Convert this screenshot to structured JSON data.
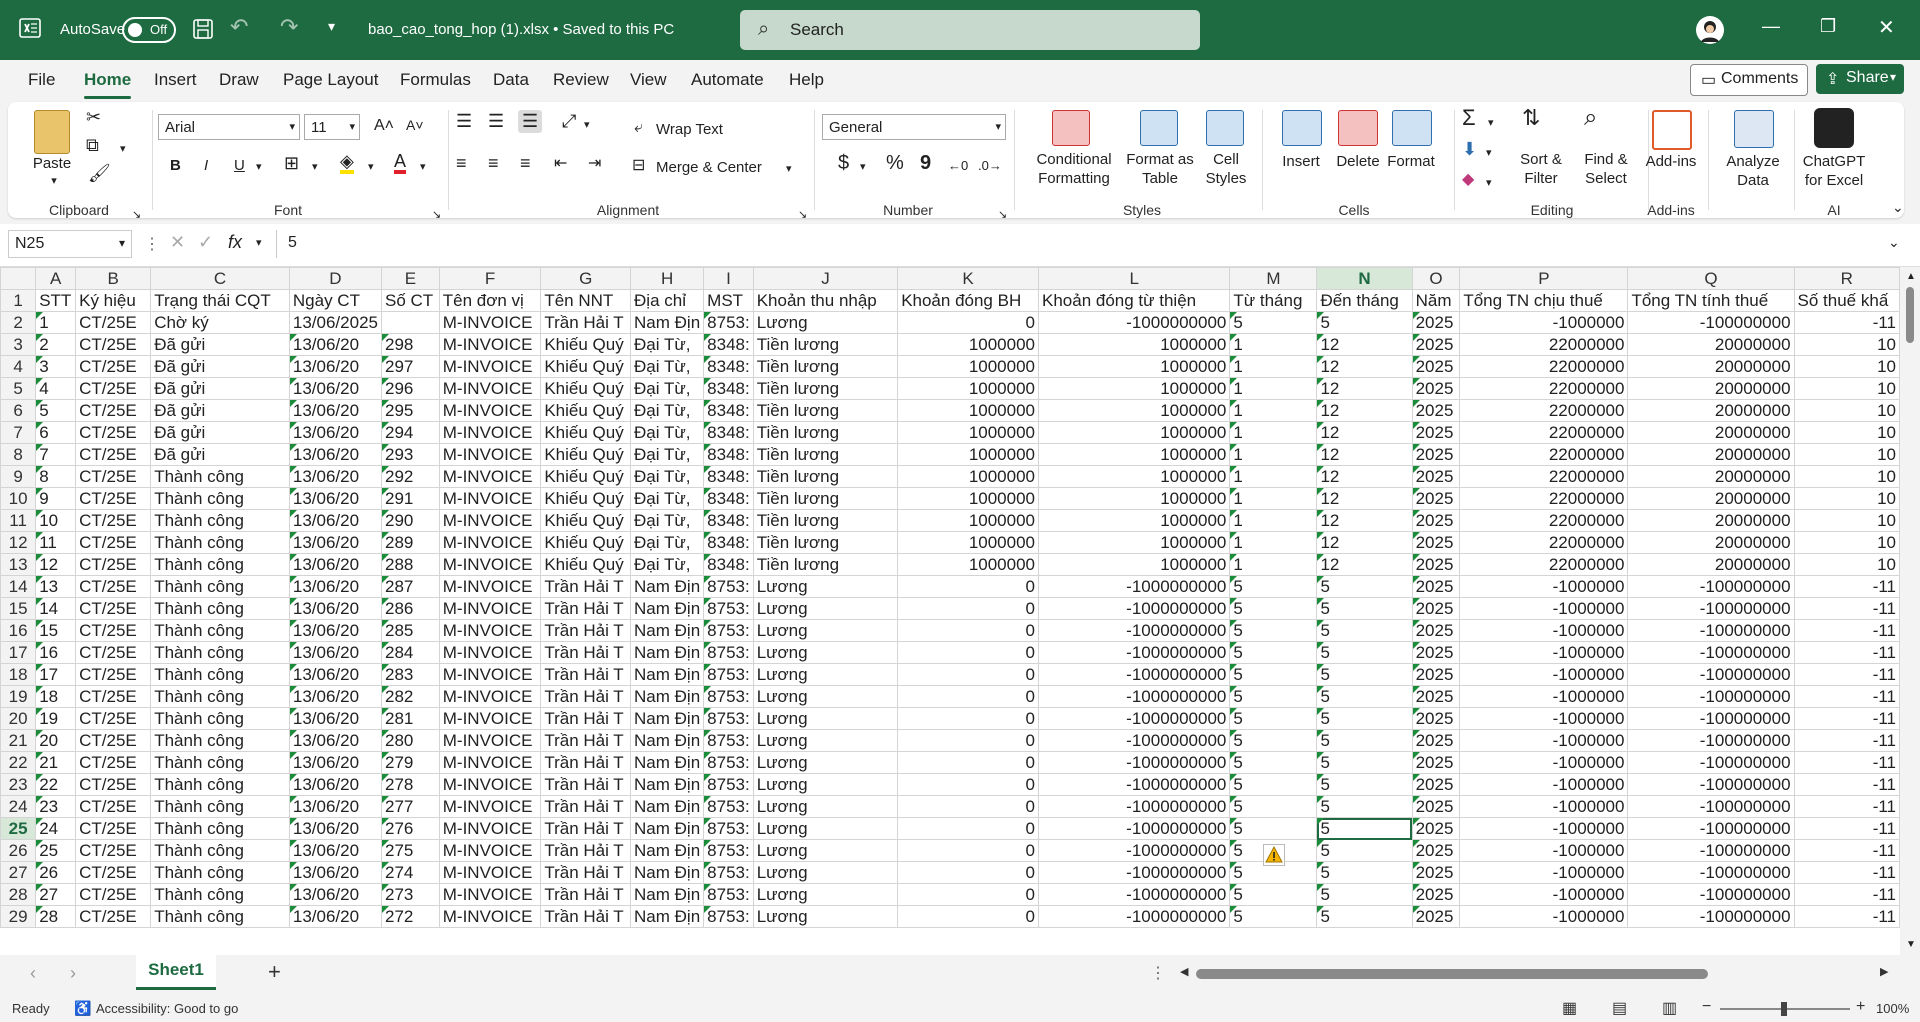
{
  "titlebar": {
    "autosave_label": "AutoSave",
    "toggle_text": "Off",
    "filename": "bao_cao_tong_hop (1).xlsx • Saved to this PC",
    "search_placeholder": "Search"
  },
  "menu": {
    "tabs": [
      "File",
      "Home",
      "Insert",
      "Draw",
      "Page Layout",
      "Formulas",
      "Data",
      "Review",
      "View",
      "Automate",
      "Help"
    ],
    "comments": "Comments",
    "share": "Share"
  },
  "ribbon": {
    "clipboard": {
      "paste": "Paste",
      "label": "Clipboard"
    },
    "font": {
      "name": "Arial",
      "size": "11",
      "label": "Font",
      "bold": "B",
      "italic": "I",
      "underline": "U"
    },
    "alignment": {
      "wrap": "Wrap Text",
      "merge": "Merge & Center",
      "label": "Alignment"
    },
    "number": {
      "format": "General",
      "dollar": "$",
      "percent": "%",
      "comma": "9",
      "label": "Number"
    },
    "styles": {
      "conditional": "Conditional\nFormatting",
      "format_table": "Format as\nTable",
      "cell_styles": "Cell\nStyles",
      "label": "Styles"
    },
    "cells": {
      "insert": "Insert",
      "delete": "Delete",
      "format": "Format",
      "label": "Cells"
    },
    "editing": {
      "sort": "Sort &\nFilter",
      "find": "Find &\nSelect",
      "label": "Editing"
    },
    "addins": {
      "addins": "Add-ins",
      "label": "Add-ins"
    },
    "analyze": {
      "text": "Analyze\nData"
    },
    "ai": {
      "chatgpt": "ChatGPT\nfor Excel",
      "label": "AI"
    }
  },
  "formula_bar": {
    "name_box": "N25",
    "fx": "fx",
    "value": "5"
  },
  "grid": {
    "columns": [
      "A",
      "B",
      "C",
      "D",
      "E",
      "F",
      "G",
      "H",
      "I",
      "J",
      "K",
      "L",
      "M",
      "N",
      "O",
      "P",
      "Q",
      "R"
    ],
    "selected_column": "N",
    "selected_row": 25,
    "headers": [
      "STT",
      "Ký hiệu",
      "Trạng thái CQT",
      "Ngày CT",
      "Số CT",
      "Tên đơn vị",
      "Tên NNT",
      "Địa chỉ",
      "MST",
      "Khoản thu nhập",
      "Khoản đóng BH",
      "Khoản đóng từ thiện",
      "Từ tháng",
      "Đến tháng",
      "Năm",
      "Tổng TN chịu thuế",
      "Tổng TN tính thuế",
      "Số thuế khấ"
    ],
    "rows": [
      [
        "1",
        "CT/25E",
        "Chờ ký",
        "13/06/2025",
        "",
        "M-INVOICE",
        "Trần Hải T",
        "Nam Địn",
        "8753:",
        "Lương",
        "0",
        "-1000000000",
        "5",
        "5",
        "2025",
        "-1000000",
        "-100000000",
        "-11"
      ],
      [
        "2",
        "CT/25E",
        "Đã gửi",
        "13/06/20",
        "298",
        "M-INVOICE",
        "Khiếu Quý",
        "Đại Từ,",
        "8348:",
        "Tiền lương",
        "1000000",
        "1000000",
        "1",
        "12",
        "2025",
        "22000000",
        "20000000",
        "10"
      ],
      [
        "3",
        "CT/25E",
        "Đã gửi",
        "13/06/20",
        "297",
        "M-INVOICE",
        "Khiếu Quý",
        "Đại Từ,",
        "8348:",
        "Tiền lương",
        "1000000",
        "1000000",
        "1",
        "12",
        "2025",
        "22000000",
        "20000000",
        "10"
      ],
      [
        "4",
        "CT/25E",
        "Đã gửi",
        "13/06/20",
        "296",
        "M-INVOICE",
        "Khiếu Quý",
        "Đại Từ,",
        "8348:",
        "Tiền lương",
        "1000000",
        "1000000",
        "1",
        "12",
        "2025",
        "22000000",
        "20000000",
        "10"
      ],
      [
        "5",
        "CT/25E",
        "Đã gửi",
        "13/06/20",
        "295",
        "M-INVOICE",
        "Khiếu Quý",
        "Đại Từ,",
        "8348:",
        "Tiền lương",
        "1000000",
        "1000000",
        "1",
        "12",
        "2025",
        "22000000",
        "20000000",
        "10"
      ],
      [
        "6",
        "CT/25E",
        "Đã gửi",
        "13/06/20",
        "294",
        "M-INVOICE",
        "Khiếu Quý",
        "Đại Từ,",
        "8348:",
        "Tiền lương",
        "1000000",
        "1000000",
        "1",
        "12",
        "2025",
        "22000000",
        "20000000",
        "10"
      ],
      [
        "7",
        "CT/25E",
        "Đã gửi",
        "13/06/20",
        "293",
        "M-INVOICE",
        "Khiếu Quý",
        "Đại Từ,",
        "8348:",
        "Tiền lương",
        "1000000",
        "1000000",
        "1",
        "12",
        "2025",
        "22000000",
        "20000000",
        "10"
      ],
      [
        "8",
        "CT/25E",
        "Thành công",
        "13/06/20",
        "292",
        "M-INVOICE",
        "Khiếu Quý",
        "Đại Từ,",
        "8348:",
        "Tiền lương",
        "1000000",
        "1000000",
        "1",
        "12",
        "2025",
        "22000000",
        "20000000",
        "10"
      ],
      [
        "9",
        "CT/25E",
        "Thành công",
        "13/06/20",
        "291",
        "M-INVOICE",
        "Khiếu Quý",
        "Đại Từ,",
        "8348:",
        "Tiền lương",
        "1000000",
        "1000000",
        "1",
        "12",
        "2025",
        "22000000",
        "20000000",
        "10"
      ],
      [
        "10",
        "CT/25E",
        "Thành công",
        "13/06/20",
        "290",
        "M-INVOICE",
        "Khiếu Quý",
        "Đại Từ,",
        "8348:",
        "Tiền lương",
        "1000000",
        "1000000",
        "1",
        "12",
        "2025",
        "22000000",
        "20000000",
        "10"
      ],
      [
        "11",
        "CT/25E",
        "Thành công",
        "13/06/20",
        "289",
        "M-INVOICE",
        "Khiếu Quý",
        "Đại Từ,",
        "8348:",
        "Tiền lương",
        "1000000",
        "1000000",
        "1",
        "12",
        "2025",
        "22000000",
        "20000000",
        "10"
      ],
      [
        "12",
        "CT/25E",
        "Thành công",
        "13/06/20",
        "288",
        "M-INVOICE",
        "Khiếu Quý",
        "Đại Từ,",
        "8348:",
        "Tiền lương",
        "1000000",
        "1000000",
        "1",
        "12",
        "2025",
        "22000000",
        "20000000",
        "10"
      ],
      [
        "13",
        "CT/25E",
        "Thành công",
        "13/06/20",
        "287",
        "M-INVOICE",
        "Trần Hải T",
        "Nam Địn",
        "8753:",
        "Lương",
        "0",
        "-1000000000",
        "5",
        "5",
        "2025",
        "-1000000",
        "-100000000",
        "-11"
      ],
      [
        "14",
        "CT/25E",
        "Thành công",
        "13/06/20",
        "286",
        "M-INVOICE",
        "Trần Hải T",
        "Nam Địn",
        "8753:",
        "Lương",
        "0",
        "-1000000000",
        "5",
        "5",
        "2025",
        "-1000000",
        "-100000000",
        "-11"
      ],
      [
        "15",
        "CT/25E",
        "Thành công",
        "13/06/20",
        "285",
        "M-INVOICE",
        "Trần Hải T",
        "Nam Địn",
        "8753:",
        "Lương",
        "0",
        "-1000000000",
        "5",
        "5",
        "2025",
        "-1000000",
        "-100000000",
        "-11"
      ],
      [
        "16",
        "CT/25E",
        "Thành công",
        "13/06/20",
        "284",
        "M-INVOICE",
        "Trần Hải T",
        "Nam Địn",
        "8753:",
        "Lương",
        "0",
        "-1000000000",
        "5",
        "5",
        "2025",
        "-1000000",
        "-100000000",
        "-11"
      ],
      [
        "17",
        "CT/25E",
        "Thành công",
        "13/06/20",
        "283",
        "M-INVOICE",
        "Trần Hải T",
        "Nam Địn",
        "8753:",
        "Lương",
        "0",
        "-1000000000",
        "5",
        "5",
        "2025",
        "-1000000",
        "-100000000",
        "-11"
      ],
      [
        "18",
        "CT/25E",
        "Thành công",
        "13/06/20",
        "282",
        "M-INVOICE",
        "Trần Hải T",
        "Nam Địn",
        "8753:",
        "Lương",
        "0",
        "-1000000000",
        "5",
        "5",
        "2025",
        "-1000000",
        "-100000000",
        "-11"
      ],
      [
        "19",
        "CT/25E",
        "Thành công",
        "13/06/20",
        "281",
        "M-INVOICE",
        "Trần Hải T",
        "Nam Địn",
        "8753:",
        "Lương",
        "0",
        "-1000000000",
        "5",
        "5",
        "2025",
        "-1000000",
        "-100000000",
        "-11"
      ],
      [
        "20",
        "CT/25E",
        "Thành công",
        "13/06/20",
        "280",
        "M-INVOICE",
        "Trần Hải T",
        "Nam Địn",
        "8753:",
        "Lương",
        "0",
        "-1000000000",
        "5",
        "5",
        "2025",
        "-1000000",
        "-100000000",
        "-11"
      ],
      [
        "21",
        "CT/25E",
        "Thành công",
        "13/06/20",
        "279",
        "M-INVOICE",
        "Trần Hải T",
        "Nam Địn",
        "8753:",
        "Lương",
        "0",
        "-1000000000",
        "5",
        "5",
        "2025",
        "-1000000",
        "-100000000",
        "-11"
      ],
      [
        "22",
        "CT/25E",
        "Thành công",
        "13/06/20",
        "278",
        "M-INVOICE",
        "Trần Hải T",
        "Nam Địn",
        "8753:",
        "Lương",
        "0",
        "-1000000000",
        "5",
        "5",
        "2025",
        "-1000000",
        "-100000000",
        "-11"
      ],
      [
        "23",
        "CT/25E",
        "Thành công",
        "13/06/20",
        "277",
        "M-INVOICE",
        "Trần Hải T",
        "Nam Địn",
        "8753:",
        "Lương",
        "0",
        "-1000000000",
        "5",
        "5",
        "2025",
        "-1000000",
        "-100000000",
        "-11"
      ],
      [
        "24",
        "CT/25E",
        "Thành công",
        "13/06/20",
        "276",
        "M-INVOICE",
        "Trần Hải T",
        "Nam Địn",
        "8753:",
        "Lương",
        "0",
        "-1000000000",
        "5",
        "5",
        "2025",
        "-1000000",
        "-100000000",
        "-11"
      ],
      [
        "25",
        "CT/25E",
        "Thành công",
        "13/06/20",
        "275",
        "M-INVOICE",
        "Trần Hải T",
        "Nam Địn",
        "8753:",
        "Lương",
        "0",
        "-1000000000",
        "5",
        "5",
        "2025",
        "-1000000",
        "-100000000",
        "-11"
      ],
      [
        "26",
        "CT/25E",
        "Thành công",
        "13/06/20",
        "274",
        "M-INVOICE",
        "Trần Hải T",
        "Nam Địn",
        "8753:",
        "Lương",
        "0",
        "-1000000000",
        "5",
        "5",
        "2025",
        "-1000000",
        "-100000000",
        "-11"
      ],
      [
        "27",
        "CT/25E",
        "Thành công",
        "13/06/20",
        "273",
        "M-INVOICE",
        "Trần Hải T",
        "Nam Địn",
        "8753:",
        "Lương",
        "0",
        "-1000000000",
        "5",
        "5",
        "2025",
        "-1000000",
        "-100000000",
        "-11"
      ],
      [
        "28",
        "CT/25E",
        "Thành công",
        "13/06/20",
        "272",
        "M-INVOICE",
        "Trần Hải T",
        "Nam Địn",
        "8753:",
        "Lương",
        "0",
        "-1000000000",
        "5",
        "5",
        "2025",
        "-1000000",
        "-100000000",
        "-11"
      ]
    ]
  },
  "sheet_tabs": {
    "active": "Sheet1",
    "add": "+"
  },
  "status": {
    "ready": "Ready",
    "accessibility": "Accessibility: Good to go",
    "zoom": "100%"
  },
  "colors": {
    "accent": "#1e6b41"
  }
}
